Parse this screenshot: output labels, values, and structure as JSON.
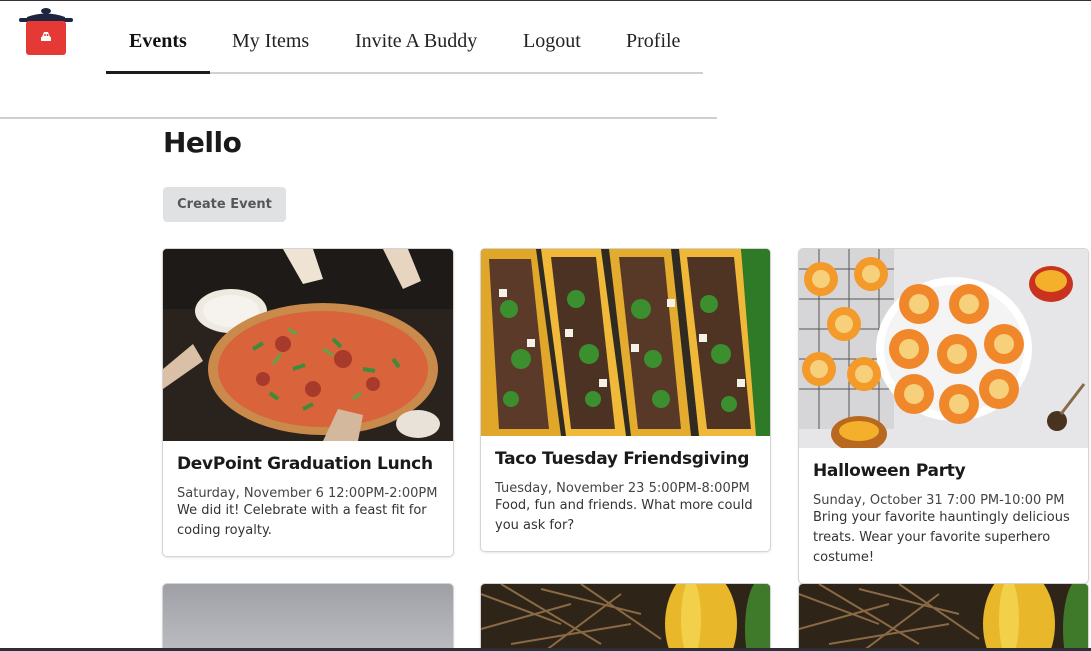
{
  "app": {
    "logo_icon": "cooking-pot-icon",
    "colors": {
      "logo_red": "#e53935",
      "logo_navy": "#1f2540",
      "nav_underline": "#1b1b1b",
      "button_bg": "#e0e1e2"
    }
  },
  "nav": {
    "items": [
      {
        "label": "Events",
        "active": true
      },
      {
        "label": "My Items"
      },
      {
        "label": "Invite A Buddy"
      },
      {
        "label": "Logout"
      },
      {
        "label": "Profile"
      }
    ]
  },
  "main": {
    "greeting": "Hello",
    "create_button": "Create Event"
  },
  "events": [
    {
      "title": "DevPoint Graduation Lunch",
      "datetime": "Saturday, November 6 12:00PM-2:00PM",
      "description_lines": [
        "We did it! Celebrate with a feast fit for",
        "coding royalty."
      ],
      "image": "pizza-photo"
    },
    {
      "title": "Taco Tuesday Friendsgiving",
      "datetime": "Tuesday, November 23 5:00PM-8:00PM",
      "description_lines": [
        "Food, fun and friends. What more could",
        "you ask for?"
      ],
      "image": "tacos-photo"
    },
    {
      "title": "Halloween Party",
      "datetime": "Sunday, October 31 7:00 PM-10:00 PM",
      "description_lines": [
        "Bring your favorite hauntingly delicious",
        "treats. Wear your favorite superhero",
        "costume!"
      ],
      "image": "halloween-cookies-photo"
    },
    {
      "image": "gray-placeholder-photo"
    },
    {
      "image": "gourd-straw-photo"
    },
    {
      "image": "gourd-straw-photo"
    }
  ]
}
